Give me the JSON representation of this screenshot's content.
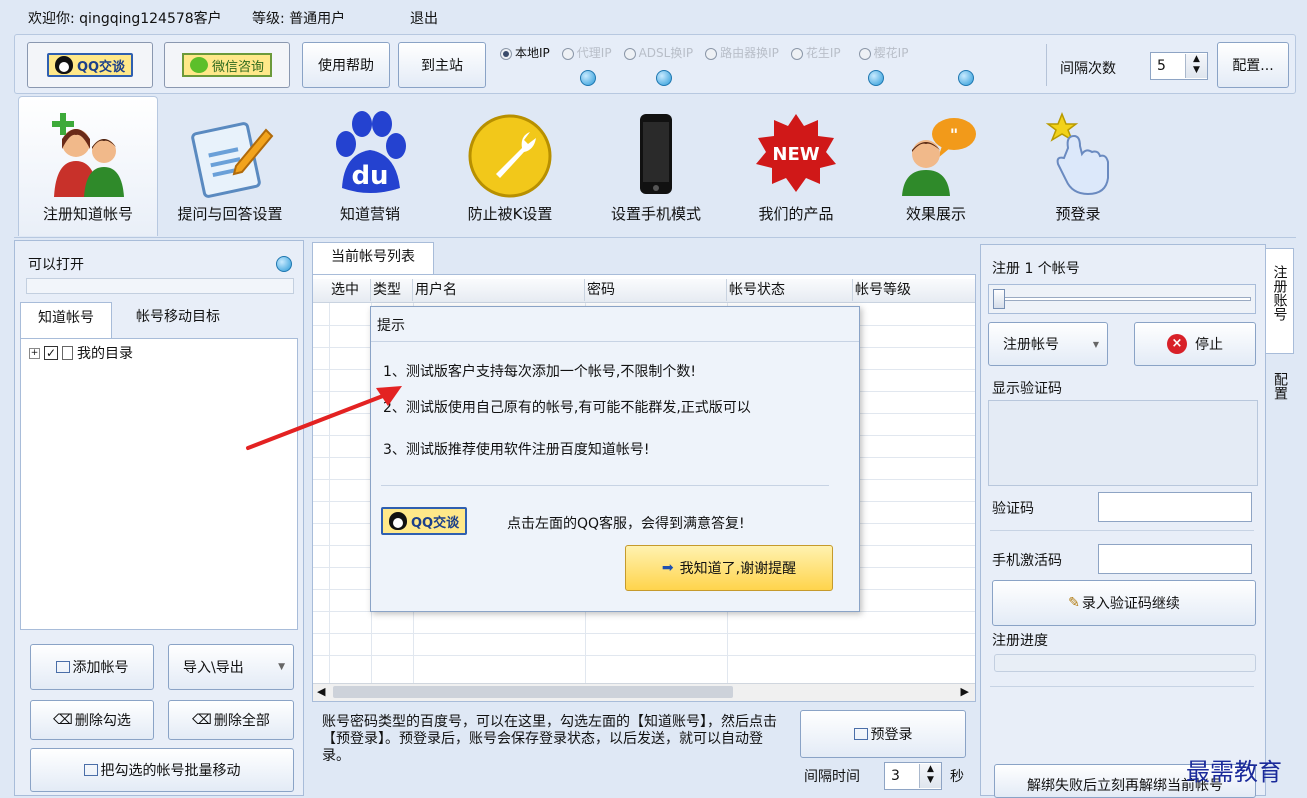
{
  "topbar": {
    "welcome": "欢迎你: qingqing124578客户",
    "level": "等级: 普通用户",
    "logout": "退出"
  },
  "toolbar": {
    "qq_btn": "QQ交谈",
    "wechat_btn": "微信咨询",
    "help_btn": "使用帮助",
    "home_btn": "到主站",
    "ip_options": [
      "本地IP",
      "代理IP",
      "ADSL换IP",
      "路由器换IP",
      "花生IP",
      "樱花IP"
    ],
    "interval_label": "间隔次数",
    "interval_value": "5",
    "config_btn": "配置..."
  },
  "ribbon": [
    {
      "label": "注册知道帐号",
      "icon": "users-icon"
    },
    {
      "label": "提问与回答设置",
      "icon": "notepad-icon"
    },
    {
      "label": "知道营销",
      "icon": "baidu-icon"
    },
    {
      "label": "防止被K设置",
      "icon": "wrench-icon"
    },
    {
      "label": "设置手机模式",
      "icon": "phone-icon"
    },
    {
      "label": "我们的产品",
      "icon": "new-badge-icon"
    },
    {
      "label": "效果展示",
      "icon": "speech-person-icon"
    },
    {
      "label": "预登录",
      "icon": "hand-star-icon"
    }
  ],
  "left": {
    "title": "可以打开",
    "tabs": [
      "知道帐号",
      "帐号移动目标"
    ],
    "tree_item": "我的目录",
    "add_btn": "添加帐号",
    "import_btn": "导入\\导出",
    "del_checked_btn": "删除勾选",
    "del_all_btn": "删除全部",
    "move_btn": "把勾选的帐号批量移动"
  },
  "center": {
    "tab": "当前帐号列表",
    "columns": [
      "选中",
      "类型",
      "用户名",
      "密码",
      "帐号状态",
      "帐号等级"
    ],
    "info_text": "账号密码类型的百度号，可以在这里，勾选左面的【知道账号】，然后点击【预登录】。预登录后，账号会保存登录状态，以后发送，就可以自动登录。",
    "prelogin_btn": "预登录",
    "interval_label": "间隔时间",
    "interval_value": "3",
    "interval_unit": "秒"
  },
  "dialog": {
    "title": "提示",
    "line1": "1、测试版客户支持每次添加一个帐号,不限制个数!",
    "line2": "2、测试版使用自己原有的帐号,有可能不能群发,正式版可以",
    "line3": "3、测试版推荐使用软件注册百度知道帐号!",
    "qq_btn": "QQ交谈",
    "qq_hint": "点击左面的QQ客服，会得到满意答复!",
    "ok_btn": "我知道了,谢谢提醒"
  },
  "right": {
    "register_label": "注册 1 个帐号",
    "slider_value": 0,
    "register_btn": "注册帐号",
    "stop_btn": "停止",
    "show_captcha": "显示验证码",
    "captcha_label": "验证码",
    "phone_code_label": "手机激活码",
    "submit_captcha_btn": "录入验证码继续",
    "progress_label": "注册进度",
    "unbind_btn": "解绑失败后立刻再解绑当前帐号",
    "side_tabs": [
      "注册账号",
      "配置"
    ]
  },
  "watermark": "最需教育"
}
